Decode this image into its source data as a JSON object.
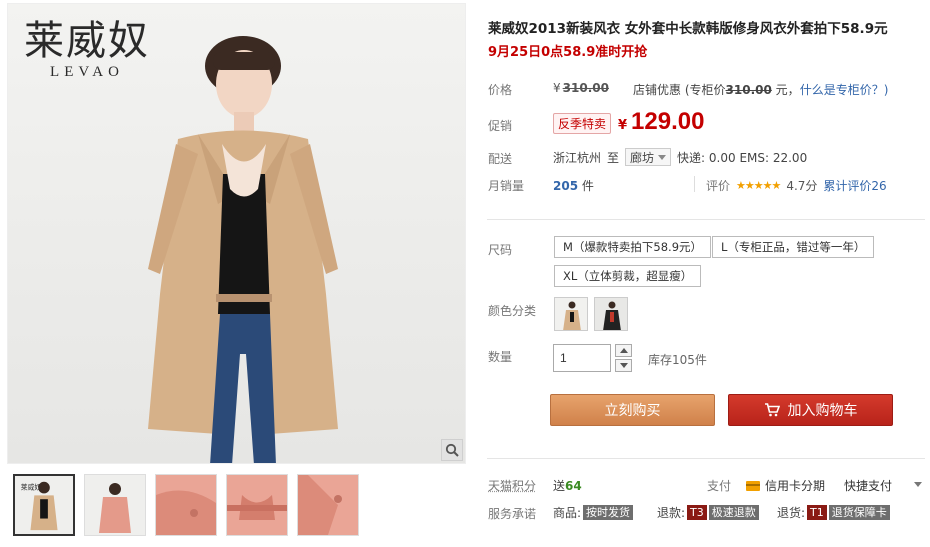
{
  "brand": {
    "logo_cn": "莱威奴",
    "logo_en": "LEVAO"
  },
  "product": {
    "title": "莱威奴2013新装风衣 女外套中长款韩版修身风衣外套拍下58.9元",
    "subtitle": "9月25日0点58.9准时开抢"
  },
  "price": {
    "label": "价格",
    "currency": "¥",
    "original": "310.00",
    "shop_discount_prefix": "店铺优惠",
    "counter_price_text": "(专柜价",
    "counter_price": "310.00",
    "counter_price_suffix": "元，",
    "counter_price_link": "什么是专柜价？)"
  },
  "promo": {
    "label": "促销",
    "badge": "反季特卖",
    "currency": "¥",
    "price": "129.00"
  },
  "shipping": {
    "label": "配送",
    "from": "浙江杭州",
    "to_word": "至",
    "destination": "廊坊",
    "fees": "快递: 0.00 EMS: 22.00"
  },
  "sales": {
    "label": "月销量",
    "count": "205",
    "unit": "件",
    "rating_label": "评价",
    "stars": "★★★★★",
    "score": "4.7分",
    "reviews_link": "累计评价26",
    "rating_value": 4.7
  },
  "sku": {
    "size_label": "尺码",
    "sizes": [
      "M（爆款特卖拍下58.9元）",
      "L（专柜正品，错过等一年）",
      "XL（立体剪裁，超显瘦）"
    ],
    "color_label": "颜色分类",
    "colors": [
      "khaki-coat",
      "black-coat"
    ],
    "qty_label": "数量",
    "qty_value": "1",
    "stock": "库存105件"
  },
  "actions": {
    "buy_now": "立刻购买",
    "add_to_cart": "加入购物车"
  },
  "footer": {
    "points_label": "天猫积分",
    "points_prefix": "送",
    "points": "64",
    "pay_label": "支付",
    "pay_credit": "信用卡分期",
    "pay_quick": "快捷支付",
    "service_label": "服务承诺",
    "services": [
      {
        "prefix": "商品:",
        "tag": "按时发货"
      },
      {
        "prefix": "退款:",
        "tag": "T3",
        "text": "极速退款"
      },
      {
        "prefix": "退货:",
        "tag": "T1",
        "text": "退货保障卡"
      }
    ]
  },
  "colors": {
    "accent_red": "#c40000",
    "buy_orange": "#d98c53",
    "cart_red": "#c52c20",
    "link_blue": "#3366aa"
  }
}
